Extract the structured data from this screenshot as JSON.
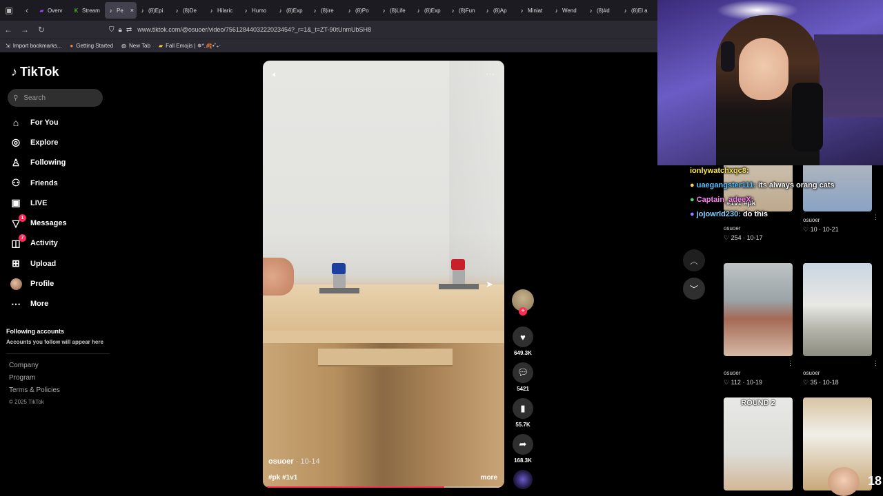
{
  "browser": {
    "tabs": [
      {
        "label": "Overv",
        "icon": "twitch-icon"
      },
      {
        "label": "Stream",
        "icon": "kick-icon"
      },
      {
        "label": "Pe",
        "icon": "tiktok-icon",
        "active": true
      },
      {
        "label": "(8)Epi",
        "icon": "tiktok-icon"
      },
      {
        "label": "(8)De",
        "icon": "tiktok-icon"
      },
      {
        "label": "Hilaric",
        "icon": "tiktok-icon"
      },
      {
        "label": "Humo",
        "icon": "tiktok-icon"
      },
      {
        "label": "(8)Exp",
        "icon": "tiktok-icon"
      },
      {
        "label": "(8)ire",
        "icon": "tiktok-icon"
      },
      {
        "label": "(8)Po",
        "icon": "tiktok-icon"
      },
      {
        "label": "(8)Life",
        "icon": "tiktok-icon"
      },
      {
        "label": "(8)Exp",
        "icon": "tiktok-icon"
      },
      {
        "label": "(8)Fun",
        "icon": "tiktok-icon"
      },
      {
        "label": "(8)Ap",
        "icon": "tiktok-icon"
      },
      {
        "label": "Miniat",
        "icon": "tiktok-icon"
      },
      {
        "label": "Wend",
        "icon": "tiktok-icon"
      },
      {
        "label": "(8)#d",
        "icon": "tiktok-icon"
      },
      {
        "label": "(8)El a",
        "icon": "tiktok-icon"
      }
    ],
    "close_glyph": "×",
    "url": "www.tiktok.com/@osuoer/video/7561284403222023454?_r=1&_t=ZT-90tUnmUbSH8",
    "bookmarks": [
      {
        "label": "Import bookmarks...",
        "icon": "import-icon"
      },
      {
        "label": "Getting Started",
        "icon": "firefox-icon"
      },
      {
        "label": "New Tab",
        "icon": "globe-icon"
      },
      {
        "label": "Fall Emojis | ✵*.🍂•˚₊‧",
        "icon": "folder-icon"
      }
    ]
  },
  "tiktok": {
    "brand": "TikTok",
    "search_placeholder": "Search",
    "nav": [
      {
        "label": "For You",
        "icon": "home-icon"
      },
      {
        "label": "Explore",
        "icon": "compass-icon"
      },
      {
        "label": "Following",
        "icon": "following-icon"
      },
      {
        "label": "Friends",
        "icon": "friends-icon"
      },
      {
        "label": "LIVE",
        "icon": "live-icon"
      },
      {
        "label": "Messages",
        "icon": "messages-icon",
        "badge": "1"
      },
      {
        "label": "Activity",
        "icon": "activity-icon",
        "badge": "7"
      },
      {
        "label": "Upload",
        "icon": "upload-icon"
      },
      {
        "label": "Profile",
        "icon": "profile-avatar"
      },
      {
        "label": "More",
        "icon": "more-icon"
      }
    ],
    "following_title": "Following accounts",
    "following_desc": "Accounts you follow will appear here",
    "footer": [
      "Company",
      "Program",
      "Terms & Policies"
    ],
    "copyright": "© 2025 TikTok"
  },
  "video": {
    "author": "osuoer",
    "date": "· 10-14",
    "tags": "#pk #1v1",
    "more": "more",
    "progress": 0.75,
    "likes": "649.3K",
    "comments": "5421",
    "saves": "55.7K",
    "shares": "168.3K"
  },
  "feed": [
    {
      "user": "osuoer",
      "likes": "254",
      "date": "10-17",
      "title": "#1v1 #pk"
    },
    {
      "user": "osuoer",
      "likes": "10",
      "date": "10-21",
      "title": ""
    },
    {
      "user": "osuoer",
      "likes": "112",
      "date": "10-19",
      "title": ""
    },
    {
      "user": "osuoer",
      "likes": "35",
      "date": "10-18",
      "title": ""
    },
    {
      "user": "",
      "likes": "",
      "date": "",
      "title": "ROUND 2"
    },
    {
      "user": "",
      "likes": "",
      "date": "",
      "title": ""
    }
  ],
  "chat": [
    {
      "user": "ionlywatchxqc8:",
      "message": "",
      "color": "#ffe84a"
    },
    {
      "user": "uaegangster111:",
      "message": "its always orang cats",
      "color": "#57c1ff"
    },
    {
      "user": "Captain_adeeX:",
      "message": "",
      "color": "#ff7df2"
    },
    {
      "user": "jojowrld230:",
      "message": "do this",
      "color": "#8ad0ff"
    }
  ],
  "corner_number": "18"
}
